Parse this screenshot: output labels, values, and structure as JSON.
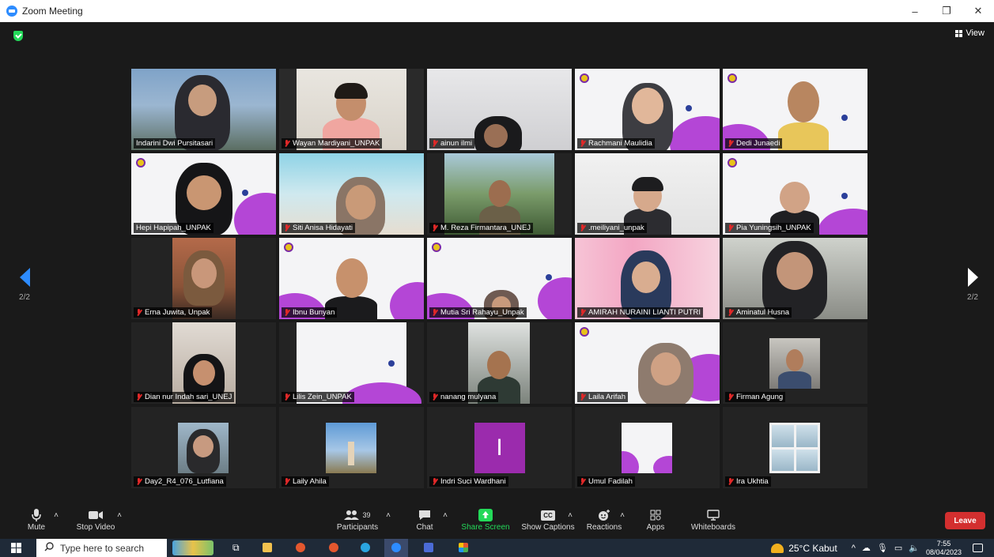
{
  "window": {
    "title": "Zoom Meeting",
    "minimize": "–",
    "restore": "❐",
    "close": "✕"
  },
  "header": {
    "view_label": "View"
  },
  "pager": {
    "left": "2/2",
    "right": "2/2"
  },
  "tiles": [
    {
      "name": "Indarini Dwi Pursitasari",
      "muted": false
    },
    {
      "name": "Wayan Mardiyani_UNPAK",
      "muted": true
    },
    {
      "name": "ainun ilmi",
      "muted": true
    },
    {
      "name": "Rachmani Maulidia",
      "muted": true
    },
    {
      "name": "Dedi Junaedi",
      "muted": true
    },
    {
      "name": "Hepi Hapipah_UNPAK",
      "muted": false
    },
    {
      "name": "Siti Anisa Hidayati",
      "muted": true
    },
    {
      "name": "M. Reza Firmantara_UNEJ",
      "muted": true
    },
    {
      "name": ".meiliyani_unpak",
      "muted": true
    },
    {
      "name": "Pia Yuningsih_UNPAK",
      "muted": true
    },
    {
      "name": "Erna Juwita, Unpak",
      "muted": true
    },
    {
      "name": "Ibnu Bunyan",
      "muted": true
    },
    {
      "name": "Mutia Sri Rahayu_Unpak",
      "muted": true
    },
    {
      "name": "AMIRAH NURAINI LIANTI PUTRI",
      "muted": true
    },
    {
      "name": "Aminatul Husna",
      "muted": true
    },
    {
      "name": "Dian nur Indah sari_UNEJ",
      "muted": true
    },
    {
      "name": "Lilis Zein_UNPAK",
      "muted": true
    },
    {
      "name": "nanang mulyana",
      "muted": true
    },
    {
      "name": "Laila Arifah",
      "muted": true
    },
    {
      "name": "Firman Agung",
      "muted": true
    },
    {
      "name": "Day2_R4_076_Lutfiana",
      "muted": true
    },
    {
      "name": "Laily Ahila",
      "muted": true
    },
    {
      "name": "Indri Suci Wardhani",
      "muted": true,
      "initial": "I"
    },
    {
      "name": "Umul Fadilah",
      "muted": true
    },
    {
      "name": "Ira Ukhtia",
      "muted": true
    }
  ],
  "toolbar": {
    "mute": "Mute",
    "stop_video": "Stop Video",
    "participants": "Participants",
    "participants_count": "39",
    "chat": "Chat",
    "share_screen": "Share Screen",
    "show_captions": "Show Captions",
    "reactions": "Reactions",
    "apps": "Apps",
    "whiteboards": "Whiteboards",
    "leave": "Leave",
    "cc": "CC"
  },
  "taskbar": {
    "search_placeholder": "Type here to search",
    "weather": "25°C  Kabut",
    "time": "7:55",
    "date": "08/04/2023"
  },
  "colors": {
    "zoom_blue": "#2d8cff",
    "leave_red": "#d32f2f",
    "share_green": "#23d959",
    "muted_red": "#e02828",
    "template_purple": "#b446d6"
  }
}
